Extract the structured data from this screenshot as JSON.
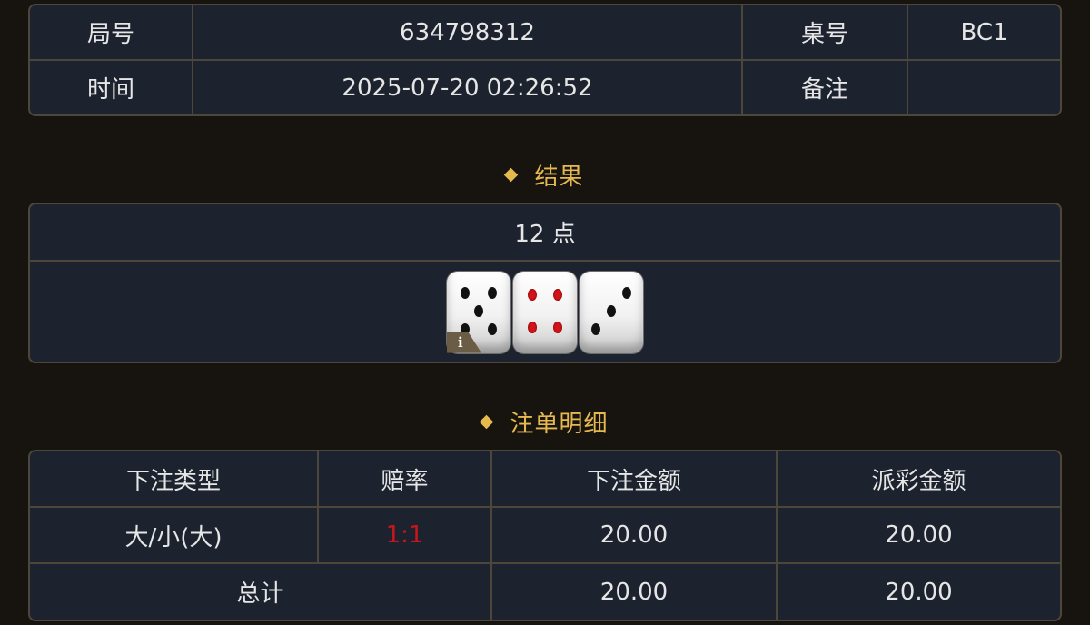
{
  "info": {
    "round_label": "局号",
    "round_value": "634798312",
    "table_label": "桌号",
    "table_value": "BC1",
    "time_label": "时间",
    "time_value": "2025-07-20 02:26:52",
    "remark_label": "备注",
    "remark_value": ""
  },
  "result": {
    "title": "结果",
    "points": "12 点",
    "dice": [
      5,
      4,
      3
    ],
    "info_icon": "i"
  },
  "detail": {
    "title": "注单明细",
    "headers": [
      "下注类型",
      "赔率",
      "下注金额",
      "派彩金额"
    ],
    "rows": [
      {
        "type": "大/小(大)",
        "odds": "1:1",
        "bet": "20.00",
        "payout": "20.00"
      }
    ],
    "total": {
      "label": "总计",
      "bet": "20.00",
      "payout": "20.00"
    }
  },
  "colors": {
    "accent": "#e5b94e",
    "odds": "#c8161d",
    "border": "#4d463a",
    "panel": "#1c222e"
  }
}
